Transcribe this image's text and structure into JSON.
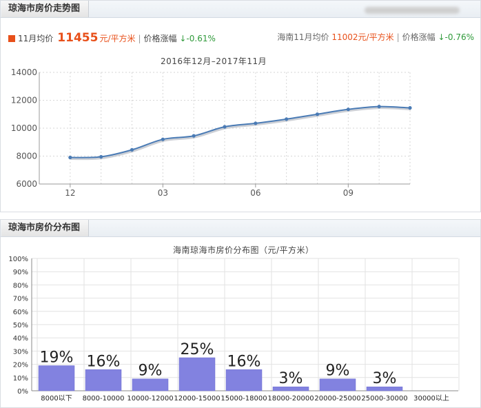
{
  "trend": {
    "tab_title": "琼海市房价走势图",
    "stat_month": "11月均价",
    "stat_price": "11455",
    "stat_unit": "元/平方米",
    "stat_change_label": "价格涨幅",
    "stat_change": "↓-0.61%",
    "prov_label": "海南11月均价",
    "prov_price": "11002元/平方米",
    "prov_change_label": "价格涨幅",
    "prov_change": "↓-0.76%"
  },
  "dist": {
    "tab_title": "琼海市房价分布图"
  },
  "chart_data": [
    {
      "type": "line",
      "title": "2016年12月–2017年11月",
      "x": [
        "2016-12",
        "2017-01",
        "2017-02",
        "2017-03",
        "2017-04",
        "2017-05",
        "2017-06",
        "2017-07",
        "2017-08",
        "2017-09",
        "2017-10",
        "2017-11"
      ],
      "x_tick_labels": [
        "12",
        "03",
        "06",
        "09"
      ],
      "y": [
        7900,
        7950,
        8450,
        9200,
        9450,
        10100,
        10350,
        10650,
        11000,
        11350,
        11550,
        11455
      ],
      "ylim": [
        6000,
        14000
      ],
      "y_ticks": [
        6000,
        8000,
        10000,
        12000,
        14000
      ],
      "grid": true,
      "color": "#4a7bb5"
    },
    {
      "type": "bar",
      "title": "海南琼海市房价分布图（元/平方米）",
      "categories": [
        "8000以下",
        "8000-10000",
        "10000-12000",
        "12000-15000",
        "15000-18000",
        "18000-20000",
        "20000-25000",
        "25000-30000",
        "30000以上"
      ],
      "values": [
        19,
        16,
        9,
        25,
        16,
        3,
        9,
        3,
        0
      ],
      "data_labels": [
        "19%",
        "16%",
        "9%",
        "25%",
        "16%",
        "3%",
        "9%",
        "3%",
        ""
      ],
      "ylim": [
        0,
        100
      ],
      "y_ticks": [
        "0%",
        "10%",
        "20%",
        "30%",
        "40%",
        "50%",
        "60%",
        "70%",
        "80%",
        "90%",
        "100%"
      ],
      "grid": true,
      "color": "#8282e0"
    }
  ]
}
